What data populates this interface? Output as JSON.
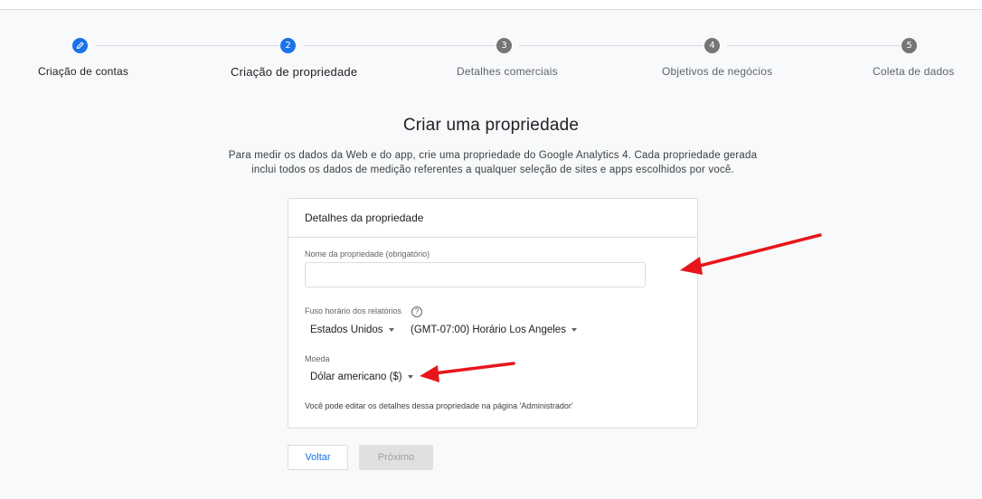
{
  "stepper": {
    "steps": [
      {
        "number": "",
        "label": "Criação de contas",
        "state": "done"
      },
      {
        "number": "2",
        "label": "Criação de propriedade",
        "state": "current"
      },
      {
        "number": "3",
        "label": "Detalhes comerciais",
        "state": "todo"
      },
      {
        "number": "4",
        "label": "Objetivos de negócios",
        "state": "todo"
      },
      {
        "number": "5",
        "label": "Coleta de dados",
        "state": "todo"
      }
    ]
  },
  "page": {
    "title": "Criar uma propriedade",
    "description": "Para medir os dados da Web e do app, crie uma propriedade do Google Analytics 4. Cada propriedade gerada inclui todos os dados de medição referentes a qualquer seleção de sites e apps escolhidos por você."
  },
  "card": {
    "title": "Detalhes da propriedade",
    "property_name_label": "Nome da propriedade (obrigatório)",
    "property_name_value": "",
    "timezone_label": "Fuso horário dos relatórios",
    "help_glyph": "?",
    "country_value": "Estados Unidos",
    "timezone_value": "(GMT-07:00) Horário Los Angeles",
    "currency_label": "Moeda",
    "currency_value": "Dólar americano ($)",
    "note": "Você pode editar os detalhes dessa propriedade na página 'Administrador'"
  },
  "buttons": {
    "back": "Voltar",
    "next": "Próximo"
  },
  "colors": {
    "accent": "#1a73e8",
    "annotation_arrow": "#e8151b"
  },
  "icons": {
    "step1": "pencil-icon",
    "help": "help-circle-icon",
    "dropdown": "caret-down-icon",
    "annotation": "red-arrow-icon"
  }
}
